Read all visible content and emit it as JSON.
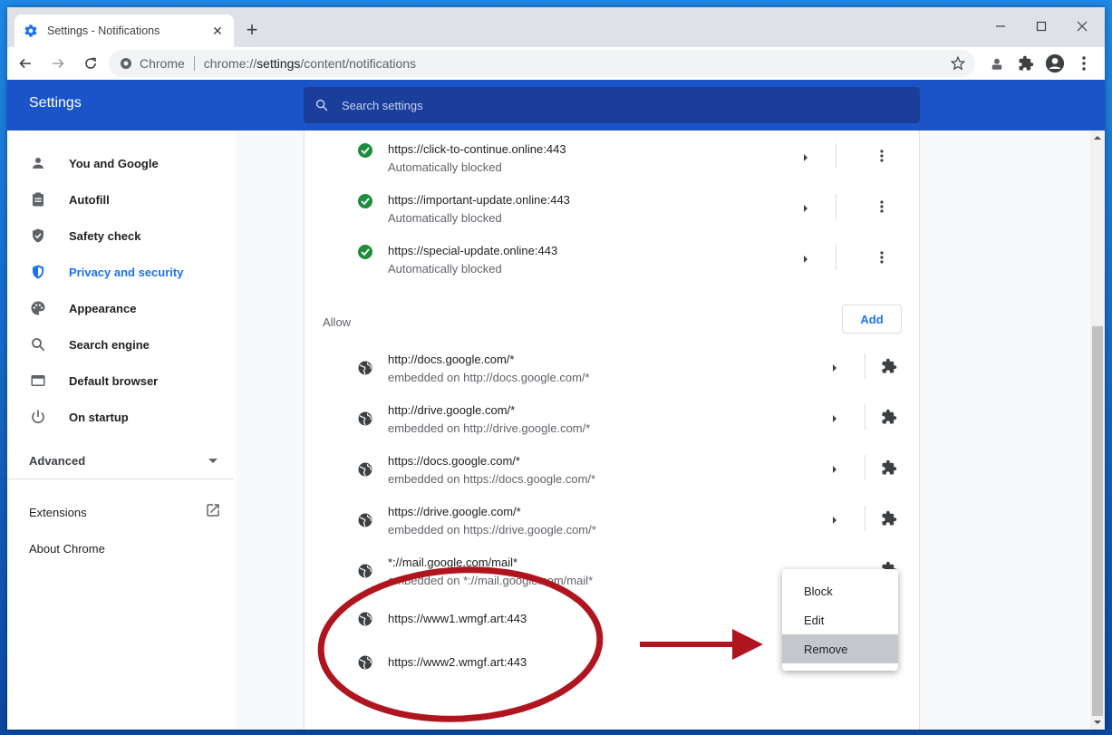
{
  "browser": {
    "tab_title": "Settings - Notifications",
    "omnibox_label": "Chrome",
    "url_prefix": "chrome://",
    "url_strong": "settings",
    "url_suffix": "/content/notifications"
  },
  "header": {
    "title": "Settings",
    "search_placeholder": "Search settings"
  },
  "sidebar": {
    "items": [
      {
        "label": "You and Google",
        "icon": "person-icon"
      },
      {
        "label": "Autofill",
        "icon": "clipboard-icon"
      },
      {
        "label": "Safety check",
        "icon": "shield-check-icon"
      },
      {
        "label": "Privacy and security",
        "icon": "shield-icon",
        "active": true
      },
      {
        "label": "Appearance",
        "icon": "palette-icon"
      },
      {
        "label": "Search engine",
        "icon": "search-icon"
      },
      {
        "label": "Default browser",
        "icon": "browser-icon"
      },
      {
        "label": "On startup",
        "icon": "power-icon"
      }
    ],
    "advanced": "Advanced",
    "extensions": "Extensions",
    "about": "About Chrome"
  },
  "blocked": [
    {
      "site": "https://click-to-continue.online:443",
      "status": "Automatically blocked"
    },
    {
      "site": "https://important-update.online:443",
      "status": "Automatically blocked"
    },
    {
      "site": "https://special-update.online:443",
      "status": "Automatically blocked"
    }
  ],
  "allow": {
    "label": "Allow",
    "add_label": "Add",
    "items": [
      {
        "site": "http://docs.google.com/*",
        "sub": "embedded on http://docs.google.com/*"
      },
      {
        "site": "http://drive.google.com/*",
        "sub": "embedded on http://drive.google.com/*"
      },
      {
        "site": "https://docs.google.com/*",
        "sub": "embedded on https://docs.google.com/*"
      },
      {
        "site": "https://drive.google.com/*",
        "sub": "embedded on https://drive.google.com/*"
      },
      {
        "site": "*://mail.google.com/mail*",
        "sub": "embedded on *://mail.google.com/mail*"
      },
      {
        "site": "https://www1.wmgf.art:443"
      },
      {
        "site": "https://www2.wmgf.art:443"
      }
    ]
  },
  "menu": {
    "block": "Block",
    "edit": "Edit",
    "remove": "Remove"
  },
  "colors": {
    "header_blue": "#1a54c8",
    "accent": "#1a73e8",
    "blocked_check": "#1e8e3e",
    "annotation_red": "#b0151f"
  }
}
